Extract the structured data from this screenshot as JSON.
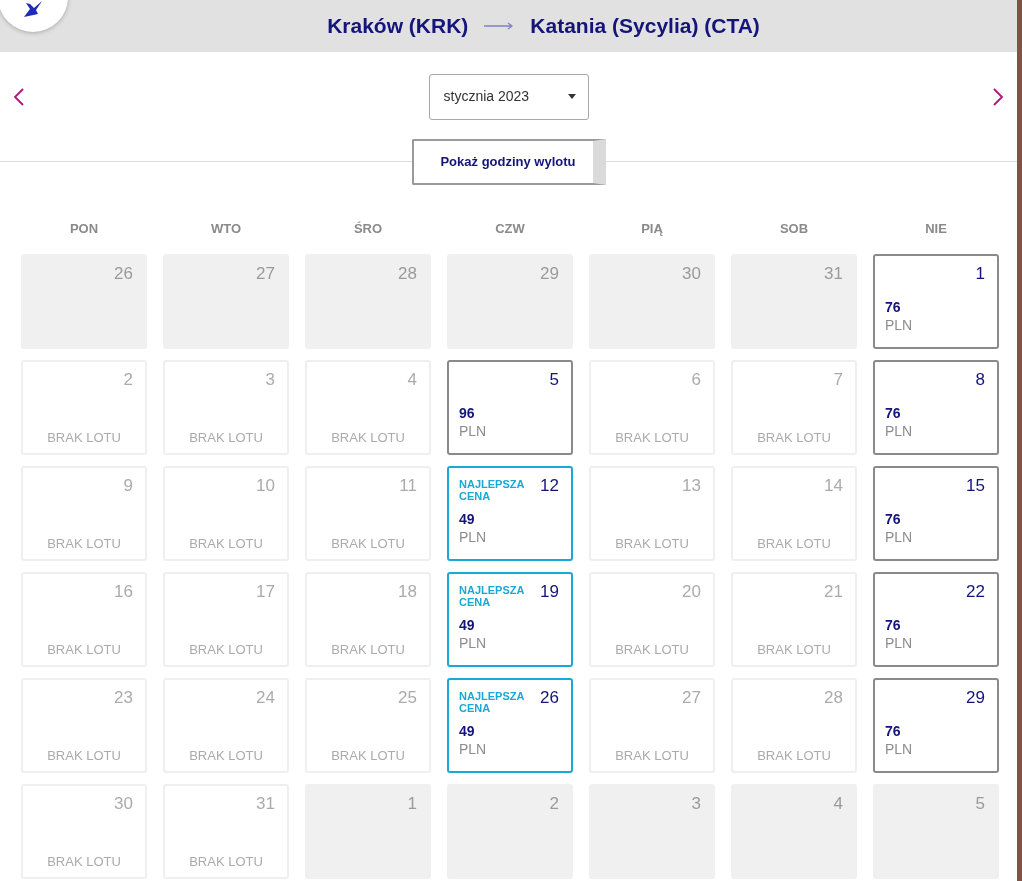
{
  "header": {
    "origin": "Kraków (KRK)",
    "destination": "Katania (Sycylia) (CTA)"
  },
  "month_select": {
    "value": "stycznia 2023"
  },
  "toggle_button": {
    "label": "Pokaż godziny wylotu"
  },
  "weekdays": [
    "PON",
    "WTO",
    "ŚRO",
    "CZW",
    "PIĄ",
    "SOB",
    "NIE"
  ],
  "weeks": [
    [
      {
        "kind": "outside",
        "day": "26"
      },
      {
        "kind": "outside",
        "day": "27"
      },
      {
        "kind": "outside",
        "day": "28"
      },
      {
        "kind": "outside",
        "day": "29"
      },
      {
        "kind": "outside",
        "day": "30"
      },
      {
        "kind": "outside",
        "day": "31"
      },
      {
        "kind": "price",
        "day": "1",
        "price": "76",
        "currency": "PLN"
      }
    ],
    [
      {
        "kind": "no_flight",
        "day": "2",
        "status": "BRAK LOTU"
      },
      {
        "kind": "no_flight",
        "day": "3",
        "status": "BRAK LOTU"
      },
      {
        "kind": "no_flight",
        "day": "4",
        "status": "BRAK LOTU"
      },
      {
        "kind": "price",
        "day": "5",
        "price": "96",
        "currency": "PLN"
      },
      {
        "kind": "no_flight",
        "day": "6",
        "status": "BRAK LOTU"
      },
      {
        "kind": "no_flight",
        "day": "7",
        "status": "BRAK LOTU"
      },
      {
        "kind": "price",
        "day": "8",
        "price": "76",
        "currency": "PLN"
      }
    ],
    [
      {
        "kind": "no_flight",
        "day": "9",
        "status": "BRAK LOTU"
      },
      {
        "kind": "no_flight",
        "day": "10",
        "status": "BRAK LOTU"
      },
      {
        "kind": "no_flight",
        "day": "11",
        "status": "BRAK LOTU"
      },
      {
        "kind": "best",
        "day": "12",
        "badge": "NAJLEPSZA CENA",
        "price": "49",
        "currency": "PLN"
      },
      {
        "kind": "no_flight",
        "day": "13",
        "status": "BRAK LOTU"
      },
      {
        "kind": "no_flight",
        "day": "14",
        "status": "BRAK LOTU"
      },
      {
        "kind": "price",
        "day": "15",
        "price": "76",
        "currency": "PLN"
      }
    ],
    [
      {
        "kind": "no_flight",
        "day": "16",
        "status": "BRAK LOTU"
      },
      {
        "kind": "no_flight",
        "day": "17",
        "status": "BRAK LOTU"
      },
      {
        "kind": "no_flight",
        "day": "18",
        "status": "BRAK LOTU"
      },
      {
        "kind": "best",
        "day": "19",
        "badge": "NAJLEPSZA CENA",
        "price": "49",
        "currency": "PLN"
      },
      {
        "kind": "no_flight",
        "day": "20",
        "status": "BRAK LOTU"
      },
      {
        "kind": "no_flight",
        "day": "21",
        "status": "BRAK LOTU"
      },
      {
        "kind": "price",
        "day": "22",
        "price": "76",
        "currency": "PLN"
      }
    ],
    [
      {
        "kind": "no_flight",
        "day": "23",
        "status": "BRAK LOTU"
      },
      {
        "kind": "no_flight",
        "day": "24",
        "status": "BRAK LOTU"
      },
      {
        "kind": "no_flight",
        "day": "25",
        "status": "BRAK LOTU"
      },
      {
        "kind": "best",
        "day": "26",
        "badge": "NAJLEPSZA CENA",
        "price": "49",
        "currency": "PLN"
      },
      {
        "kind": "no_flight",
        "day": "27",
        "status": "BRAK LOTU"
      },
      {
        "kind": "no_flight",
        "day": "28",
        "status": "BRAK LOTU"
      },
      {
        "kind": "price",
        "day": "29",
        "price": "76",
        "currency": "PLN"
      }
    ],
    [
      {
        "kind": "no_flight",
        "day": "30",
        "status": "BRAK LOTU"
      },
      {
        "kind": "no_flight",
        "day": "31",
        "status": "BRAK LOTU"
      },
      {
        "kind": "outside",
        "day": "1"
      },
      {
        "kind": "outside",
        "day": "2"
      },
      {
        "kind": "outside",
        "day": "3"
      },
      {
        "kind": "outside",
        "day": "4"
      },
      {
        "kind": "outside",
        "day": "5"
      }
    ]
  ]
}
